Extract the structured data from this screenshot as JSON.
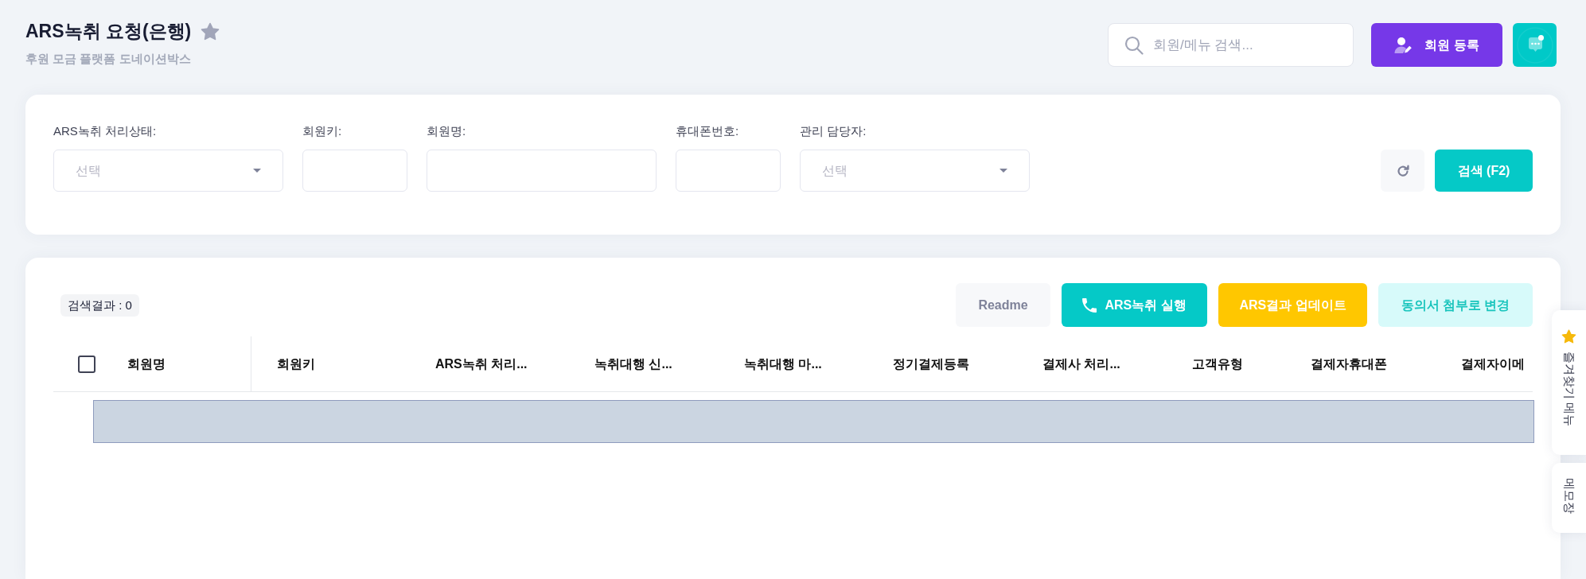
{
  "header": {
    "title": "ARS녹취 요청(은행)",
    "starred": false,
    "subtitle": "후원 모금 플랫폼 도네이션박스"
  },
  "toolbar": {
    "search": {
      "placeholder": "회원/메뉴 검색..."
    },
    "register_button": "회원 등록",
    "chat": {
      "unread": true
    }
  },
  "filters": [
    {
      "kind": "select",
      "label": "ARS녹취 처리상태:",
      "placeholder": "선택"
    },
    {
      "kind": "text",
      "label": "회원키:"
    },
    {
      "kind": "text",
      "label": "회원명:"
    },
    {
      "kind": "text",
      "label": "휴대폰번호:"
    },
    {
      "kind": "select",
      "label": "관리 담당자:",
      "placeholder": "선택"
    }
  ],
  "search_button": "검색 (F2)",
  "results": {
    "count": "검색결과 : 0",
    "actions": [
      {
        "kind": "neutral",
        "label": "Readme"
      },
      {
        "kind": "call",
        "label": "ARS녹취 실행"
      },
      {
        "kind": "warning",
        "label": "ARS결과 업데이트"
      },
      {
        "kind": "soft",
        "label": "동의서 첨부로 변경"
      }
    ]
  },
  "table": {
    "select_all": {
      "checked": false
    },
    "columns": [
      "회원명",
      "회원키",
      "ARS녹취 처리...",
      "녹취대행 신...",
      "녹취대행 마...",
      "정기결제등록",
      "결제사 처리...",
      "고객유형",
      "결제자휴대폰",
      "결제자이메"
    ]
  },
  "side_tabs": [
    {
      "kind": "favorites",
      "label": "즐겨찾기 메뉴"
    },
    {
      "kind": "memo",
      "label": "메모장"
    }
  ]
}
